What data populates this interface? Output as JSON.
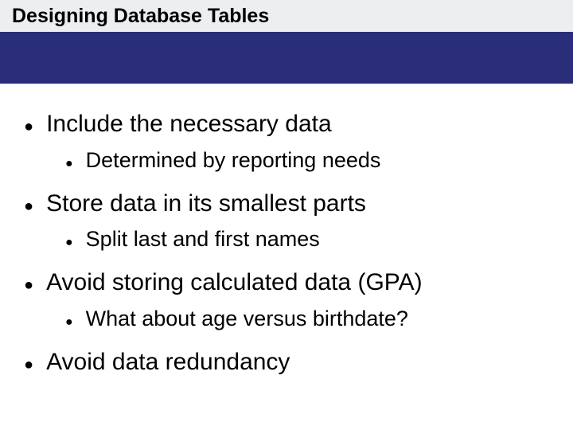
{
  "title": "Designing Database Tables",
  "bullets": {
    "b1": "Include the necessary data",
    "b1_1": "Determined by reporting needs",
    "b2": "Store data in its smallest parts",
    "b2_1": "Split last and first names",
    "b3": "Avoid storing calculated data (GPA)",
    "b3_1": "What about age versus birthdate?",
    "b4": "Avoid data redundancy"
  }
}
